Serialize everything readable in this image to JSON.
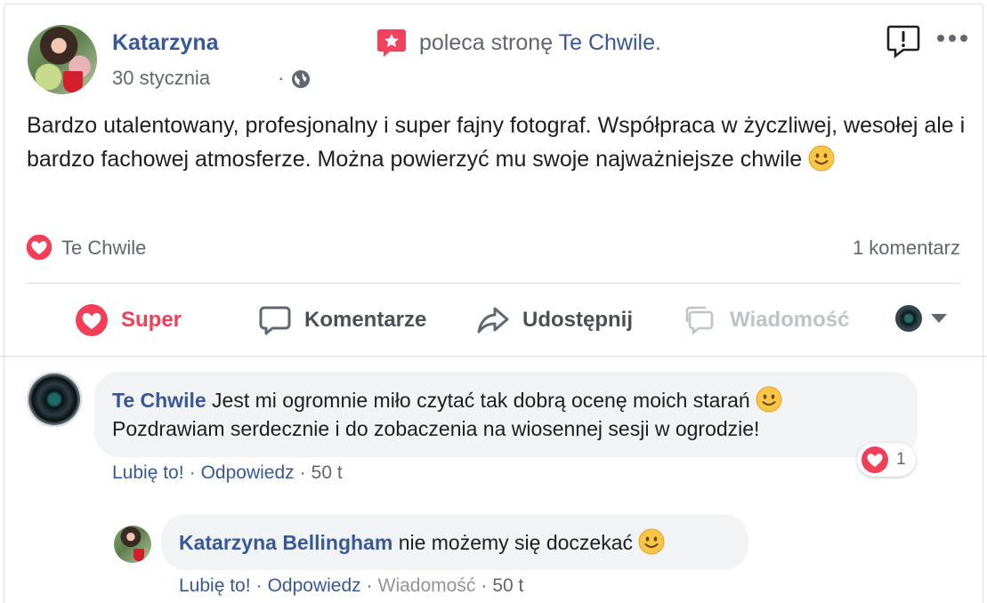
{
  "post": {
    "author": "Katarzyna",
    "date": "30 stycznia",
    "date_sep": "·",
    "recommends_prefix": "poleca stronę",
    "page_name": "Te Chwile",
    "recommends_suffix": ".",
    "text": "Bardzo utalentowany, profesjonalny i super fajny fotograf. Współpraca w życzliwej, wesołej ale i bardzo fachowej atmosferze. Można powierzyć mu swoje najważniejsze chwile"
  },
  "reactions": {
    "reactor": "Te Chwile",
    "comment_count": "1 komentarz"
  },
  "actions": {
    "super": "Super",
    "comment": "Komentarze",
    "share": "Udostępnij",
    "message": "Wiadomość"
  },
  "comments": [
    {
      "author": "Te Chwile",
      "text_line1": "Jest mi ogromnie miło czytać tak dobrą ocenę moich starań",
      "text_line2": "Pozdrawiam serdecznie i do zobaczenia na wiosennej sesji w ogrodzie!",
      "like": "Lubię to!",
      "reply": "Odpowiedz",
      "time": "50 t",
      "sep": "·",
      "reaction_count": "1"
    },
    {
      "author": "Katarzyna Bellingham",
      "text": "nie możemy się doczekać",
      "like": "Lubię to!",
      "reply": "Odpowiedz",
      "message": "Wiadomość",
      "time": "50 t",
      "sep": "·"
    }
  ],
  "colors": {
    "link_blue": "#385898",
    "super_red": "#f33e58",
    "gray_text": "#606770",
    "bubble_bg": "#f2f3f5"
  },
  "icons": [
    "globe-icon",
    "recommend-icon",
    "report-icon",
    "more-icon",
    "heart-icon",
    "comment-icon",
    "share-icon",
    "messenger-icon",
    "smiley-icon",
    "chevron-down-icon"
  ]
}
